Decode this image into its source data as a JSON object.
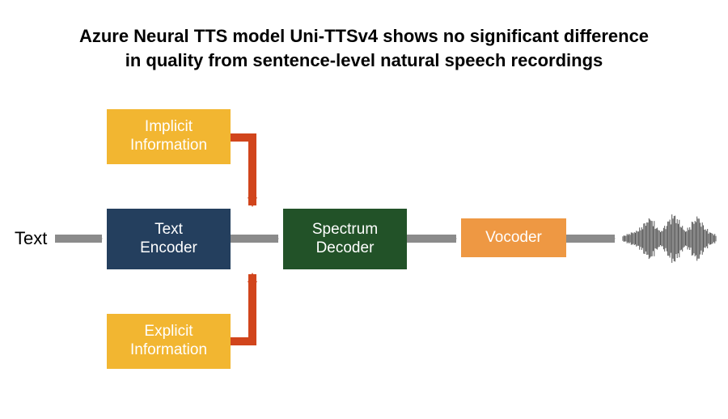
{
  "title_line1": "Azure Neural TTS model Uni-TTSv4 shows no significant difference",
  "title_line2": "in quality from sentence-level natural speech recordings",
  "input_label": "Text",
  "blocks": {
    "implicit": "Implicit\nInformation",
    "explicit": "Explicit\nInformation",
    "text_encoder": "Text\nEncoder",
    "spectrum_decoder": "Spectrum\nDecoder",
    "vocoder": "Vocoder"
  },
  "colors": {
    "yellow": "#f2b631",
    "navy": "#243f5e",
    "green": "#225228",
    "orange": "#ee9843",
    "arrow_gray": "#8b8b8b",
    "arrow_red": "#d1451c"
  },
  "output": "audio-waveform"
}
